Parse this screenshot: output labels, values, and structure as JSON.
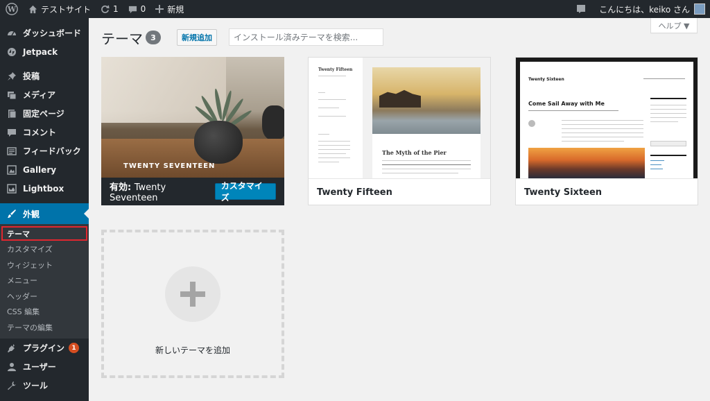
{
  "adminbar": {
    "site_name": "テストサイト",
    "updates_count": "1",
    "comments_count": "0",
    "new_label": "新規",
    "greeting": "こんにちは、keiko さん"
  },
  "sidebar": {
    "items": [
      {
        "label": "ダッシュボード",
        "icon": "dashboard-icon"
      },
      {
        "label": "Jetpack",
        "icon": "jetpack-icon"
      },
      {
        "label": "投稿",
        "icon": "pin-icon"
      },
      {
        "label": "メディア",
        "icon": "media-icon"
      },
      {
        "label": "固定ページ",
        "icon": "page-icon"
      },
      {
        "label": "コメント",
        "icon": "comment-icon"
      },
      {
        "label": "フィードバック",
        "icon": "feedback-icon"
      },
      {
        "label": "Gallery",
        "icon": "gallery-icon"
      },
      {
        "label": "Lightbox",
        "icon": "lightbox-icon"
      },
      {
        "label": "外観",
        "icon": "brush-icon"
      },
      {
        "label": "プラグイン",
        "icon": "plugin-icon",
        "badge": "1"
      },
      {
        "label": "ユーザー",
        "icon": "user-icon"
      },
      {
        "label": "ツール",
        "icon": "wrench-icon"
      }
    ],
    "submenu": [
      "テーマ",
      "カスタマイズ",
      "ウィジェット",
      "メニュー",
      "ヘッダー",
      "CSS 編集",
      "テーマの編集"
    ]
  },
  "header": {
    "title": "テーマ",
    "count": "3",
    "add_new": "新規追加",
    "search_placeholder": "インストール済みテーマを検索...",
    "help": "ヘルプ ▼"
  },
  "themes": [
    {
      "name": "Twenty Seventeen",
      "active_prefix": "有効:",
      "screenshot_title": "TWENTY SEVENTEEN",
      "customize": "カスタマイズ"
    },
    {
      "name": "Twenty Fifteen",
      "screenshot_site_title": "Twenty Fifteen",
      "screenshot_post_title": "The Myth of the Pier"
    },
    {
      "name": "Twenty Sixteen",
      "screenshot_site_title": "Twenty Sixteen",
      "screenshot_post_title": "Come Sail Away with Me"
    }
  ],
  "add_theme": {
    "label": "新しいテーマを追加"
  },
  "colors": {
    "accent": "#0073aa",
    "admin_bg": "#23282d",
    "highlight_border": "#e1272f"
  }
}
